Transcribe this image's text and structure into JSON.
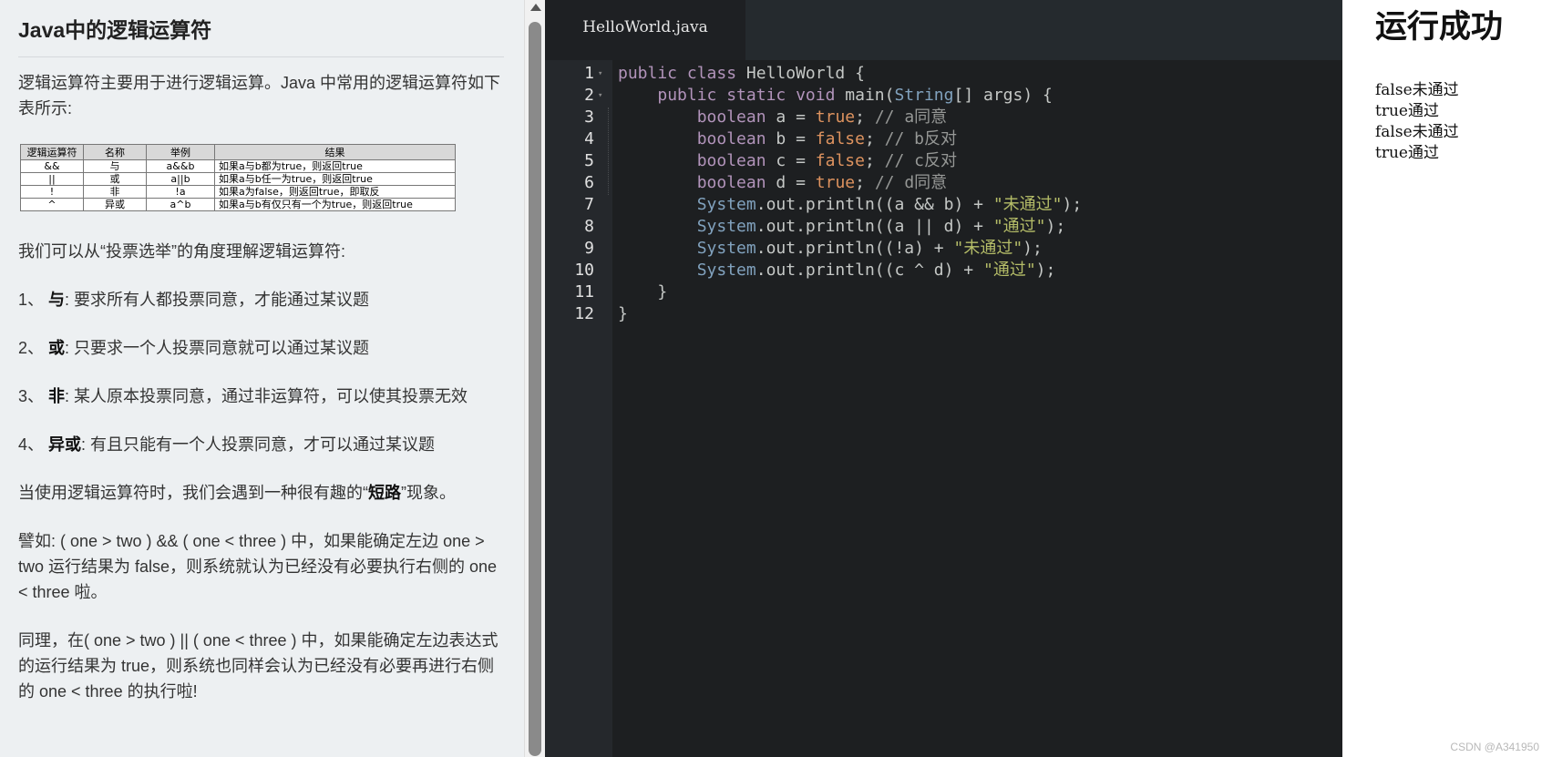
{
  "lesson": {
    "title": "Java中的逻辑运算符",
    "intro": "逻辑运算符主要用于进行逻辑运算。Java 中常用的逻辑运算符如下表所示:",
    "table": {
      "headers": [
        "逻辑运算符",
        "名称",
        "举例",
        "结果"
      ],
      "rows": [
        [
          "&&",
          "与",
          "a&&b",
          "如果a与b都为true，则返回true"
        ],
        [
          "||",
          "或",
          "a||b",
          "如果a与b任一为true，则返回true"
        ],
        [
          "!",
          "非",
          "!a",
          "如果a为false，则返回true，即取反"
        ],
        [
          "^",
          "异或",
          "a^b",
          "如果a与b有仅只有一个为true，则返回true"
        ]
      ]
    },
    "vote_intro": "我们可以从“投票选举”的角度理解逻辑运算符:",
    "items": [
      {
        "num": "1、",
        "term": "与",
        "desc": ": 要求所有人都投票同意，才能通过某议题"
      },
      {
        "num": "2、",
        "term": "或",
        "desc": ": 只要求一个人投票同意就可以通过某议题"
      },
      {
        "num": "3、",
        "term": "非",
        "desc": ": 某人原本投票同意，通过非运算符，可以使其投票无效"
      },
      {
        "num": "4、",
        "term": "异或",
        "desc": ": 有且只能有一个人投票同意，才可以通过某议题"
      }
    ],
    "short_circuit_pre": "当使用逻辑运算符时，我们会遇到一种很有趣的“",
    "short_circuit_term": "短路",
    "short_circuit_post": "”现象。",
    "example1": "譬如: ( one > two ) && ( one < three ) 中，如果能确定左边 one > two 运行结果为 false，则系统就认为已经没有必要执行右侧的 one < three 啦。",
    "example2": "同理，在( one > two ) || ( one < three ) 中，如果能确定左边表达式的运行结果为 true，则系统也同样会认为已经没有必要再进行右侧的 one < three 的执行啦!"
  },
  "editor": {
    "tab_label": "HelloWorld.java",
    "lines": [
      {
        "n": "1",
        "fold": true,
        "tokens": [
          [
            "kw",
            "public "
          ],
          [
            "kw",
            "class "
          ],
          [
            "pl",
            "HelloWorld {"
          ]
        ]
      },
      {
        "n": "2",
        "fold": true,
        "tokens": [
          [
            "pl",
            "    "
          ],
          [
            "kw",
            "public "
          ],
          [
            "kw",
            "static "
          ],
          [
            "kw",
            "void "
          ],
          [
            "pl",
            "main("
          ],
          [
            "tp",
            "String"
          ],
          [
            "pl",
            "[] args) {"
          ]
        ]
      },
      {
        "n": "3",
        "fold": false,
        "tokens": [
          [
            "pl",
            "        "
          ],
          [
            "kw",
            "boolean "
          ],
          [
            "pl",
            "a = "
          ],
          [
            "bo",
            "true"
          ],
          [
            "pl",
            "; "
          ],
          [
            "cm",
            "// a同意"
          ]
        ]
      },
      {
        "n": "4",
        "fold": false,
        "tokens": [
          [
            "pl",
            "        "
          ],
          [
            "kw",
            "boolean "
          ],
          [
            "pl",
            "b = "
          ],
          [
            "bo",
            "false"
          ],
          [
            "pl",
            "; "
          ],
          [
            "cm",
            "// b反对"
          ]
        ]
      },
      {
        "n": "5",
        "fold": false,
        "tokens": [
          [
            "pl",
            "        "
          ],
          [
            "kw",
            "boolean "
          ],
          [
            "pl",
            "c = "
          ],
          [
            "bo",
            "false"
          ],
          [
            "pl",
            "; "
          ],
          [
            "cm",
            "// c反对"
          ]
        ]
      },
      {
        "n": "6",
        "fold": false,
        "tokens": [
          [
            "pl",
            "        "
          ],
          [
            "kw",
            "boolean "
          ],
          [
            "pl",
            "d = "
          ],
          [
            "bo",
            "true"
          ],
          [
            "pl",
            "; "
          ],
          [
            "cm",
            "// d同意"
          ]
        ]
      },
      {
        "n": "7",
        "fold": false,
        "tokens": [
          [
            "pl",
            "        "
          ],
          [
            "tp",
            "System"
          ],
          [
            "pl",
            ".out.println((a && b) + "
          ],
          [
            "str",
            "\"未通过\""
          ],
          [
            "pl",
            ");"
          ]
        ]
      },
      {
        "n": "8",
        "fold": false,
        "tokens": [
          [
            "pl",
            "        "
          ],
          [
            "tp",
            "System"
          ],
          [
            "pl",
            ".out.println((a || d) + "
          ],
          [
            "str",
            "\"通过\""
          ],
          [
            "pl",
            ");"
          ]
        ]
      },
      {
        "n": "9",
        "fold": false,
        "tokens": [
          [
            "pl",
            "        "
          ],
          [
            "tp",
            "System"
          ],
          [
            "pl",
            ".out.println((!a) + "
          ],
          [
            "str",
            "\"未通过\""
          ],
          [
            "pl",
            ");"
          ]
        ]
      },
      {
        "n": "10",
        "fold": false,
        "tokens": [
          [
            "pl",
            "        "
          ],
          [
            "tp",
            "System"
          ],
          [
            "pl",
            ".out.println((c ^ d) + "
          ],
          [
            "str",
            "\"通过\""
          ],
          [
            "pl",
            ");"
          ]
        ]
      },
      {
        "n": "11",
        "fold": false,
        "tokens": [
          [
            "pl",
            "    }"
          ]
        ]
      },
      {
        "n": "12",
        "fold": false,
        "tokens": [
          [
            "pl",
            "}"
          ]
        ]
      }
    ]
  },
  "output": {
    "title": "运行成功",
    "lines": [
      "false未通过",
      "true通过",
      "false未通过",
      "true通过"
    ],
    "watermark": "CSDN @A341950"
  },
  "colors": {
    "keyword": "#b294bb",
    "type": "#81a2be",
    "boolean": "#de935f",
    "string": "#b5bd68",
    "comment": "#969896",
    "editor_bg": "#1d1f21",
    "lesson_bg": "#edf0f2"
  }
}
